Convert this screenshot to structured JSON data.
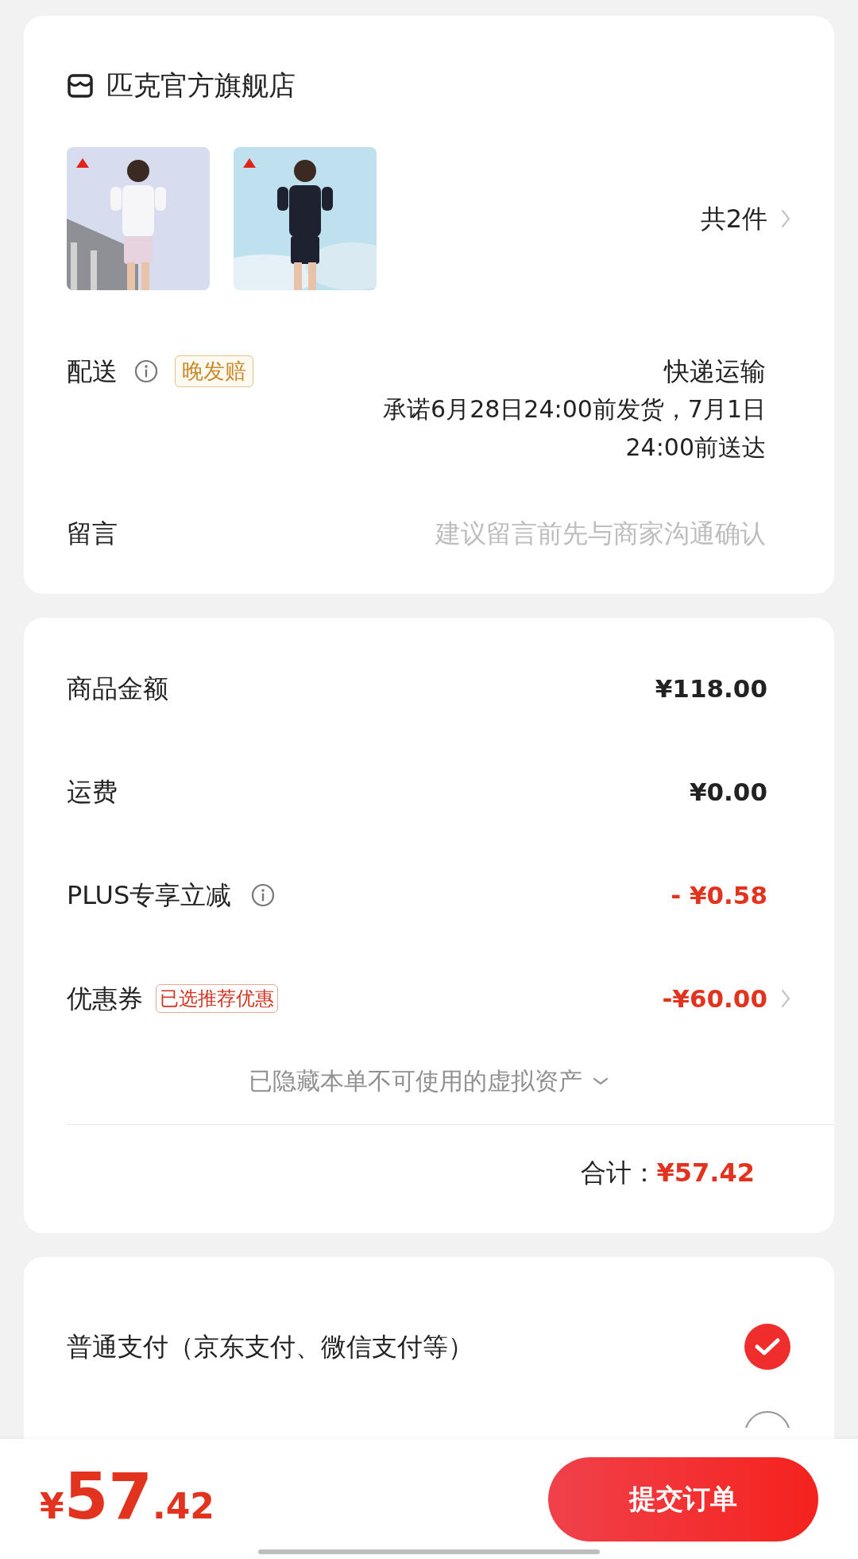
{
  "store": {
    "name": "匹克官方旗舰店",
    "count": "共2件"
  },
  "delivery": {
    "label": "配送",
    "badge": "晚发赔",
    "method": "快递运输",
    "promise": "承诺6月28日24:00前发货，7月1日",
    "promise_2": "24:00前送达"
  },
  "message": {
    "label": "留言",
    "placeholder": "建议留言前先与商家沟通确认"
  },
  "amounts": [
    {
      "kind": "plain",
      "label": "商品金额",
      "value": "¥118.00"
    },
    {
      "kind": "plain",
      "label": "运费",
      "value": "¥0.00"
    },
    {
      "kind": "info",
      "label": "PLUS专享立减",
      "value": "- ¥0.58"
    },
    {
      "kind": "coupon",
      "label": "优惠券",
      "badge": "已选推荐优惠",
      "value": "-¥60.00"
    }
  ],
  "hidden_assets": "已隐藏本单不可使用的虚拟资产",
  "total": {
    "label": "合计：",
    "value": "¥57.42"
  },
  "payment_options": [
    {
      "label": "普通支付（京东支付、微信支付等）",
      "selected": true
    },
    {
      "selected": false
    }
  ],
  "footer": {
    "currency": "¥",
    "integer": "57",
    "decimal": ".42",
    "submit": "提交订单"
  }
}
